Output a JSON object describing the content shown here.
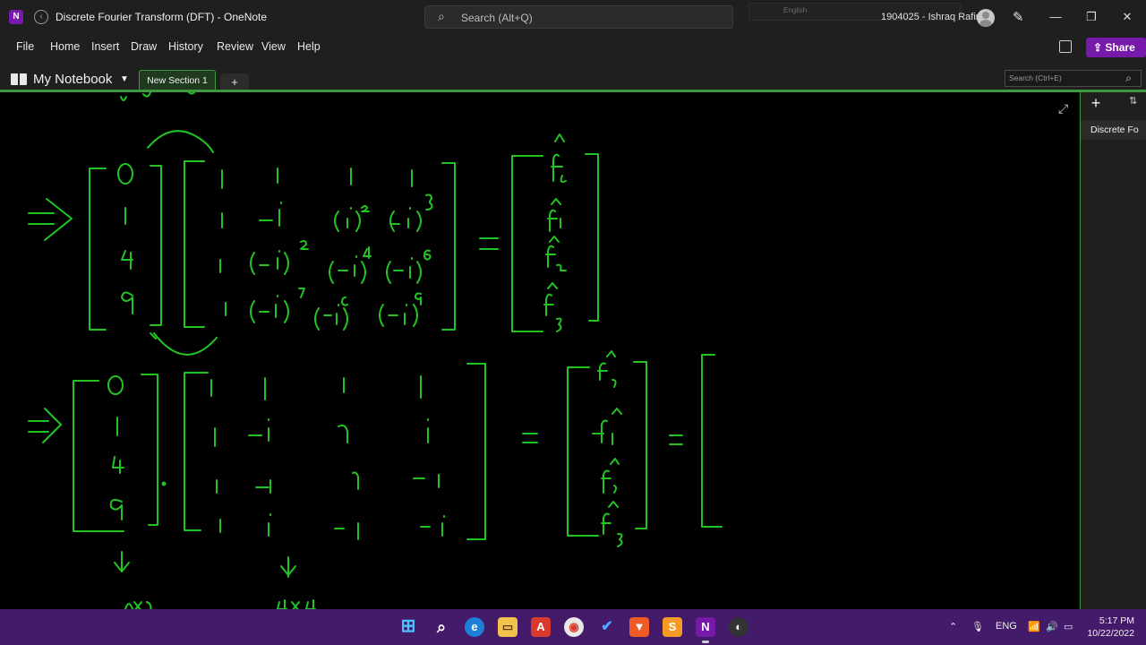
{
  "window": {
    "title": "Discrete Fourier Transform (DFT)  -  OneNote",
    "app_icon": "N",
    "search_placeholder": "Search (Alt+Q)",
    "language_hint": "English",
    "user_name": "1904025 - Ishraq Rafin",
    "controls": {
      "minimize": "—",
      "maximize": "❐",
      "close": "✕"
    }
  },
  "menu": {
    "items": [
      "File",
      "Home",
      "Insert",
      "Draw",
      "History",
      "Review",
      "View",
      "Help"
    ],
    "share_label": "Share"
  },
  "notebook": {
    "name": "My Notebook",
    "section_tab": "New Section 1",
    "add_section": "+",
    "page_search_placeholder": "Search (Ctrl+E)"
  },
  "pages": {
    "add_label": "+",
    "current": "Discrete Fo"
  },
  "ink": {
    "color": "#22c422",
    "handwriting": "Handwritten DFT matrix equations in green ink"
  },
  "taskbar": {
    "language": "ENG",
    "time": "5:17 PM",
    "date": "10/22/2022"
  },
  "colors": {
    "accent": "#7719aa",
    "section": "#3f9a3f",
    "taskbar": "#441b6b"
  }
}
